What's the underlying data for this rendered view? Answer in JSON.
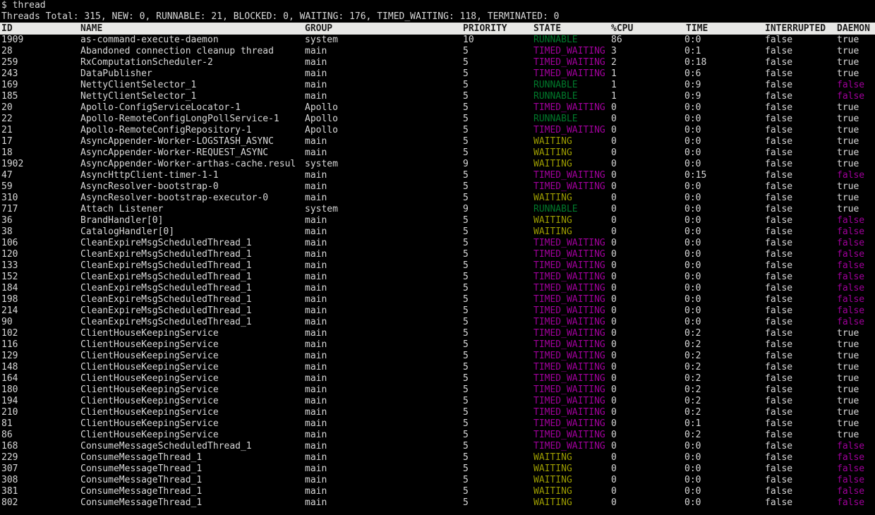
{
  "terminal": {
    "prompt": "$ thread",
    "summary": "Threads Total: 315, NEW: 0, RUNNABLE: 21, BLOCKED: 0, WAITING: 176, TIMED_WAITING: 118, TERMINATED: 0",
    "summary_values": {
      "total": 315,
      "new": 0,
      "runnable": 21,
      "blocked": 0,
      "waiting": 176,
      "timed_waiting": 118,
      "terminated": 0
    },
    "colors": {
      "background": "#000000",
      "foreground": "#d8d8d8",
      "header_bg": "#e8e8e6",
      "header_fg": "#1a1a1a",
      "runnable": "#00792b",
      "timed_waiting": "#a1009c",
      "waiting": "#9c9c00",
      "daemon_false": "#a1009c"
    }
  },
  "table": {
    "columns": [
      "ID",
      "NAME",
      "GROUP",
      "PRIORITY",
      "STATE",
      "%CPU",
      "TIME",
      "INTERRUPTED",
      "DAEMON"
    ],
    "rows": [
      {
        "id": "1909",
        "name": "as-command-execute-daemon",
        "group": "system",
        "priority": "10",
        "state": "RUNNABLE",
        "cpu": "86",
        "time": "0:0",
        "interrupted": "false",
        "daemon": "true"
      },
      {
        "id": "28",
        "name": "Abandoned connection cleanup thread",
        "group": "main",
        "priority": "5",
        "state": "TIMED_WAITING",
        "cpu": "3",
        "time": "0:1",
        "interrupted": "false",
        "daemon": "true"
      },
      {
        "id": "259",
        "name": "RxComputationScheduler-2",
        "group": "main",
        "priority": "5",
        "state": "TIMED_WAITING",
        "cpu": "2",
        "time": "0:18",
        "interrupted": "false",
        "daemon": "true"
      },
      {
        "id": "243",
        "name": "DataPublisher",
        "group": "main",
        "priority": "5",
        "state": "TIMED_WAITING",
        "cpu": "1",
        "time": "0:6",
        "interrupted": "false",
        "daemon": "true"
      },
      {
        "id": "169",
        "name": "NettyClientSelector_1",
        "group": "main",
        "priority": "5",
        "state": "RUNNABLE",
        "cpu": "1",
        "time": "0:9",
        "interrupted": "false",
        "daemon": "false"
      },
      {
        "id": "185",
        "name": "NettyClientSelector_1",
        "group": "main",
        "priority": "5",
        "state": "RUNNABLE",
        "cpu": "1",
        "time": "0:9",
        "interrupted": "false",
        "daemon": "false"
      },
      {
        "id": "20",
        "name": "Apollo-ConfigServiceLocator-1",
        "group": "Apollo",
        "priority": "5",
        "state": "TIMED_WAITING",
        "cpu": "0",
        "time": "0:0",
        "interrupted": "false",
        "daemon": "true"
      },
      {
        "id": "22",
        "name": "Apollo-RemoteConfigLongPollService-1",
        "group": "Apollo",
        "priority": "5",
        "state": "RUNNABLE",
        "cpu": "0",
        "time": "0:0",
        "interrupted": "false",
        "daemon": "true"
      },
      {
        "id": "21",
        "name": "Apollo-RemoteConfigRepository-1",
        "group": "Apollo",
        "priority": "5",
        "state": "TIMED_WAITING",
        "cpu": "0",
        "time": "0:0",
        "interrupted": "false",
        "daemon": "true"
      },
      {
        "id": "17",
        "name": "AsyncAppender-Worker-LOGSTASH_ASYNC",
        "group": "main",
        "priority": "5",
        "state": "WAITING",
        "cpu": "0",
        "time": "0:0",
        "interrupted": "false",
        "daemon": "true"
      },
      {
        "id": "18",
        "name": "AsyncAppender-Worker-REQUEST_ASYNC",
        "group": "main",
        "priority": "5",
        "state": "WAITING",
        "cpu": "0",
        "time": "0:0",
        "interrupted": "false",
        "daemon": "true"
      },
      {
        "id": "1902",
        "name": "AsyncAppender-Worker-arthas-cache.resul",
        "group": "system",
        "priority": "9",
        "state": "WAITING",
        "cpu": "0",
        "time": "0:0",
        "interrupted": "false",
        "daemon": "true"
      },
      {
        "id": "47",
        "name": "AsyncHttpClient-timer-1-1",
        "group": "main",
        "priority": "5",
        "state": "TIMED_WAITING",
        "cpu": "0",
        "time": "0:15",
        "interrupted": "false",
        "daemon": "false"
      },
      {
        "id": "59",
        "name": "AsyncResolver-bootstrap-0",
        "group": "main",
        "priority": "5",
        "state": "TIMED_WAITING",
        "cpu": "0",
        "time": "0:0",
        "interrupted": "false",
        "daemon": "true"
      },
      {
        "id": "310",
        "name": "AsyncResolver-bootstrap-executor-0",
        "group": "main",
        "priority": "5",
        "state": "WAITING",
        "cpu": "0",
        "time": "0:0",
        "interrupted": "false",
        "daemon": "true"
      },
      {
        "id": "717",
        "name": "Attach Listener",
        "group": "system",
        "priority": "9",
        "state": "RUNNABLE",
        "cpu": "0",
        "time": "0:0",
        "interrupted": "false",
        "daemon": "true"
      },
      {
        "id": "36",
        "name": "BrandHandler[0]",
        "group": "main",
        "priority": "5",
        "state": "WAITING",
        "cpu": "0",
        "time": "0:0",
        "interrupted": "false",
        "daemon": "false"
      },
      {
        "id": "38",
        "name": "CatalogHandler[0]",
        "group": "main",
        "priority": "5",
        "state": "WAITING",
        "cpu": "0",
        "time": "0:0",
        "interrupted": "false",
        "daemon": "false"
      },
      {
        "id": "106",
        "name": "CleanExpireMsgScheduledThread_1",
        "group": "main",
        "priority": "5",
        "state": "TIMED_WAITING",
        "cpu": "0",
        "time": "0:0",
        "interrupted": "false",
        "daemon": "false"
      },
      {
        "id": "120",
        "name": "CleanExpireMsgScheduledThread_1",
        "group": "main",
        "priority": "5",
        "state": "TIMED_WAITING",
        "cpu": "0",
        "time": "0:0",
        "interrupted": "false",
        "daemon": "false"
      },
      {
        "id": "133",
        "name": "CleanExpireMsgScheduledThread_1",
        "group": "main",
        "priority": "5",
        "state": "TIMED_WAITING",
        "cpu": "0",
        "time": "0:0",
        "interrupted": "false",
        "daemon": "false"
      },
      {
        "id": "152",
        "name": "CleanExpireMsgScheduledThread_1",
        "group": "main",
        "priority": "5",
        "state": "TIMED_WAITING",
        "cpu": "0",
        "time": "0:0",
        "interrupted": "false",
        "daemon": "false"
      },
      {
        "id": "184",
        "name": "CleanExpireMsgScheduledThread_1",
        "group": "main",
        "priority": "5",
        "state": "TIMED_WAITING",
        "cpu": "0",
        "time": "0:0",
        "interrupted": "false",
        "daemon": "false"
      },
      {
        "id": "198",
        "name": "CleanExpireMsgScheduledThread_1",
        "group": "main",
        "priority": "5",
        "state": "TIMED_WAITING",
        "cpu": "0",
        "time": "0:0",
        "interrupted": "false",
        "daemon": "false"
      },
      {
        "id": "214",
        "name": "CleanExpireMsgScheduledThread_1",
        "group": "main",
        "priority": "5",
        "state": "TIMED_WAITING",
        "cpu": "0",
        "time": "0:0",
        "interrupted": "false",
        "daemon": "false"
      },
      {
        "id": "90",
        "name": "CleanExpireMsgScheduledThread_1",
        "group": "main",
        "priority": "5",
        "state": "TIMED_WAITING",
        "cpu": "0",
        "time": "0:0",
        "interrupted": "false",
        "daemon": "false"
      },
      {
        "id": "102",
        "name": "ClientHouseKeepingService",
        "group": "main",
        "priority": "5",
        "state": "TIMED_WAITING",
        "cpu": "0",
        "time": "0:2",
        "interrupted": "false",
        "daemon": "true"
      },
      {
        "id": "116",
        "name": "ClientHouseKeepingService",
        "group": "main",
        "priority": "5",
        "state": "TIMED_WAITING",
        "cpu": "0",
        "time": "0:2",
        "interrupted": "false",
        "daemon": "true"
      },
      {
        "id": "129",
        "name": "ClientHouseKeepingService",
        "group": "main",
        "priority": "5",
        "state": "TIMED_WAITING",
        "cpu": "0",
        "time": "0:2",
        "interrupted": "false",
        "daemon": "true"
      },
      {
        "id": "148",
        "name": "ClientHouseKeepingService",
        "group": "main",
        "priority": "5",
        "state": "TIMED_WAITING",
        "cpu": "0",
        "time": "0:2",
        "interrupted": "false",
        "daemon": "true"
      },
      {
        "id": "164",
        "name": "ClientHouseKeepingService",
        "group": "main",
        "priority": "5",
        "state": "TIMED_WAITING",
        "cpu": "0",
        "time": "0:2",
        "interrupted": "false",
        "daemon": "true"
      },
      {
        "id": "180",
        "name": "ClientHouseKeepingService",
        "group": "main",
        "priority": "5",
        "state": "TIMED_WAITING",
        "cpu": "0",
        "time": "0:2",
        "interrupted": "false",
        "daemon": "true"
      },
      {
        "id": "194",
        "name": "ClientHouseKeepingService",
        "group": "main",
        "priority": "5",
        "state": "TIMED_WAITING",
        "cpu": "0",
        "time": "0:2",
        "interrupted": "false",
        "daemon": "true"
      },
      {
        "id": "210",
        "name": "ClientHouseKeepingService",
        "group": "main",
        "priority": "5",
        "state": "TIMED_WAITING",
        "cpu": "0",
        "time": "0:2",
        "interrupted": "false",
        "daemon": "true"
      },
      {
        "id": "81",
        "name": "ClientHouseKeepingService",
        "group": "main",
        "priority": "5",
        "state": "TIMED_WAITING",
        "cpu": "0",
        "time": "0:1",
        "interrupted": "false",
        "daemon": "true"
      },
      {
        "id": "86",
        "name": "ClientHouseKeepingService",
        "group": "main",
        "priority": "5",
        "state": "TIMED_WAITING",
        "cpu": "0",
        "time": "0:2",
        "interrupted": "false",
        "daemon": "true"
      },
      {
        "id": "168",
        "name": "ConsumeMessageScheduledThread_1",
        "group": "main",
        "priority": "5",
        "state": "TIMED_WAITING",
        "cpu": "0",
        "time": "0:0",
        "interrupted": "false",
        "daemon": "false"
      },
      {
        "id": "229",
        "name": "ConsumeMessageThread_1",
        "group": "main",
        "priority": "5",
        "state": "WAITING",
        "cpu": "0",
        "time": "0:0",
        "interrupted": "false",
        "daemon": "false"
      },
      {
        "id": "307",
        "name": "ConsumeMessageThread_1",
        "group": "main",
        "priority": "5",
        "state": "WAITING",
        "cpu": "0",
        "time": "0:0",
        "interrupted": "false",
        "daemon": "false"
      },
      {
        "id": "308",
        "name": "ConsumeMessageThread_1",
        "group": "main",
        "priority": "5",
        "state": "WAITING",
        "cpu": "0",
        "time": "0:0",
        "interrupted": "false",
        "daemon": "false"
      },
      {
        "id": "381",
        "name": "ConsumeMessageThread_1",
        "group": "main",
        "priority": "5",
        "state": "WAITING",
        "cpu": "0",
        "time": "0:0",
        "interrupted": "false",
        "daemon": "false"
      },
      {
        "id": "802",
        "name": "ConsumeMessageThread_1",
        "group": "main",
        "priority": "5",
        "state": "WAITING",
        "cpu": "0",
        "time": "0:0",
        "interrupted": "false",
        "daemon": "false"
      }
    ]
  }
}
